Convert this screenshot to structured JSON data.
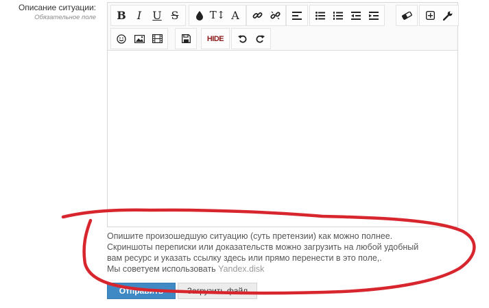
{
  "field": {
    "label": "Описание ситуации:",
    "hint": "Обязательное поле"
  },
  "toolbar": {
    "row1": [
      {
        "name": "bold-button",
        "icon": "bold-icon",
        "glyph": "B"
      },
      {
        "name": "italic-button",
        "icon": "italic-icon",
        "glyph": "I"
      },
      {
        "name": "underline-button",
        "icon": "underline-icon",
        "glyph": "U"
      },
      {
        "name": "strikethrough-button",
        "icon": "strikethrough-icon",
        "glyph": "S"
      },
      {
        "name": "text-color-button",
        "icon": "droplet-icon"
      },
      {
        "name": "font-size-button",
        "icon": "font-size-icon",
        "glyph": "T↕"
      },
      {
        "name": "font-family-button",
        "icon": "font-family-icon",
        "glyph": "A"
      },
      {
        "name": "insert-link-button",
        "icon": "link-icon"
      },
      {
        "name": "remove-link-button",
        "icon": "unlink-icon"
      },
      {
        "name": "align-button",
        "icon": "align-left-icon"
      },
      {
        "name": "bullet-list-button",
        "icon": "bullet-list-icon"
      },
      {
        "name": "numbered-list-button",
        "icon": "numbered-list-icon"
      },
      {
        "name": "outdent-button",
        "icon": "outdent-icon"
      },
      {
        "name": "indent-button",
        "icon": "indent-icon"
      },
      {
        "name": "remove-format-button",
        "icon": "eraser-icon"
      },
      {
        "name": "insert-button",
        "icon": "plus-box-icon"
      },
      {
        "name": "tools-button",
        "icon": "wrench-icon"
      }
    ],
    "row2": [
      {
        "name": "smilies-button",
        "icon": "smiley-icon"
      },
      {
        "name": "insert-image-button",
        "icon": "image-icon"
      },
      {
        "name": "insert-media-button",
        "icon": "film-icon"
      },
      {
        "name": "save-draft-button",
        "icon": "floppy-icon"
      },
      {
        "name": "hide-button",
        "icon": "hide-icon",
        "glyph": "HIDE"
      },
      {
        "name": "undo-button",
        "icon": "undo-icon"
      },
      {
        "name": "redo-button",
        "icon": "redo-icon"
      }
    ]
  },
  "help": {
    "line1": "Опишите произошедшую ситуацию (суть претензии) как можно полнее.",
    "line2": "Скриншоты переписки или доказательств можно загрузить на любой удобный",
    "line3": "вам ресурс и указать ссылку здесь или прямо перенести в это поле,.",
    "line4_prefix": "Мы советуем использовать ",
    "line4_link": "Yandex.disk"
  },
  "buttons": {
    "submit": "Отправить",
    "upload": "Загрузить файл"
  },
  "colors": {
    "submit_bg": "#3f8ac4",
    "annotation": "#d8262f"
  }
}
